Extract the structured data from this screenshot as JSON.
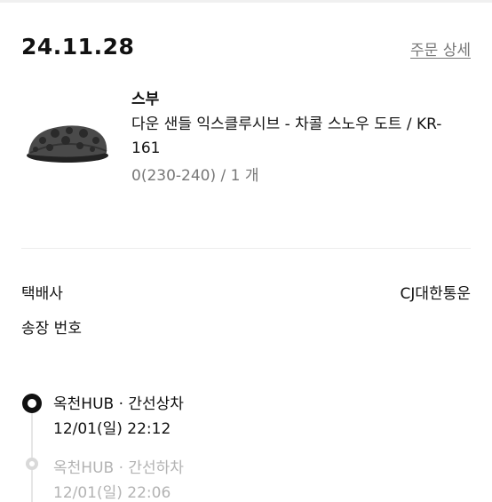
{
  "order": {
    "date": "24.11.28",
    "detail_link": "주문 상세"
  },
  "product": {
    "image_icon": "slipper-image",
    "brand": "스부",
    "name": "다운 샌들 익스클루시브 - 차콜 스노우 도트 / KR-161",
    "option": "0(230-240) / 1 개"
  },
  "shipping": {
    "courier_label": "택배사",
    "courier_value": "CJ대한통운",
    "tracking_label": "송장 번호"
  },
  "tracking_events": [
    {
      "status": "옥천HUB · 간선상차",
      "time": "12/01(일) 22:12",
      "active": true
    },
    {
      "status": "옥천HUB · 간선하차",
      "time": "12/01(일) 22:06",
      "active": false
    }
  ]
}
